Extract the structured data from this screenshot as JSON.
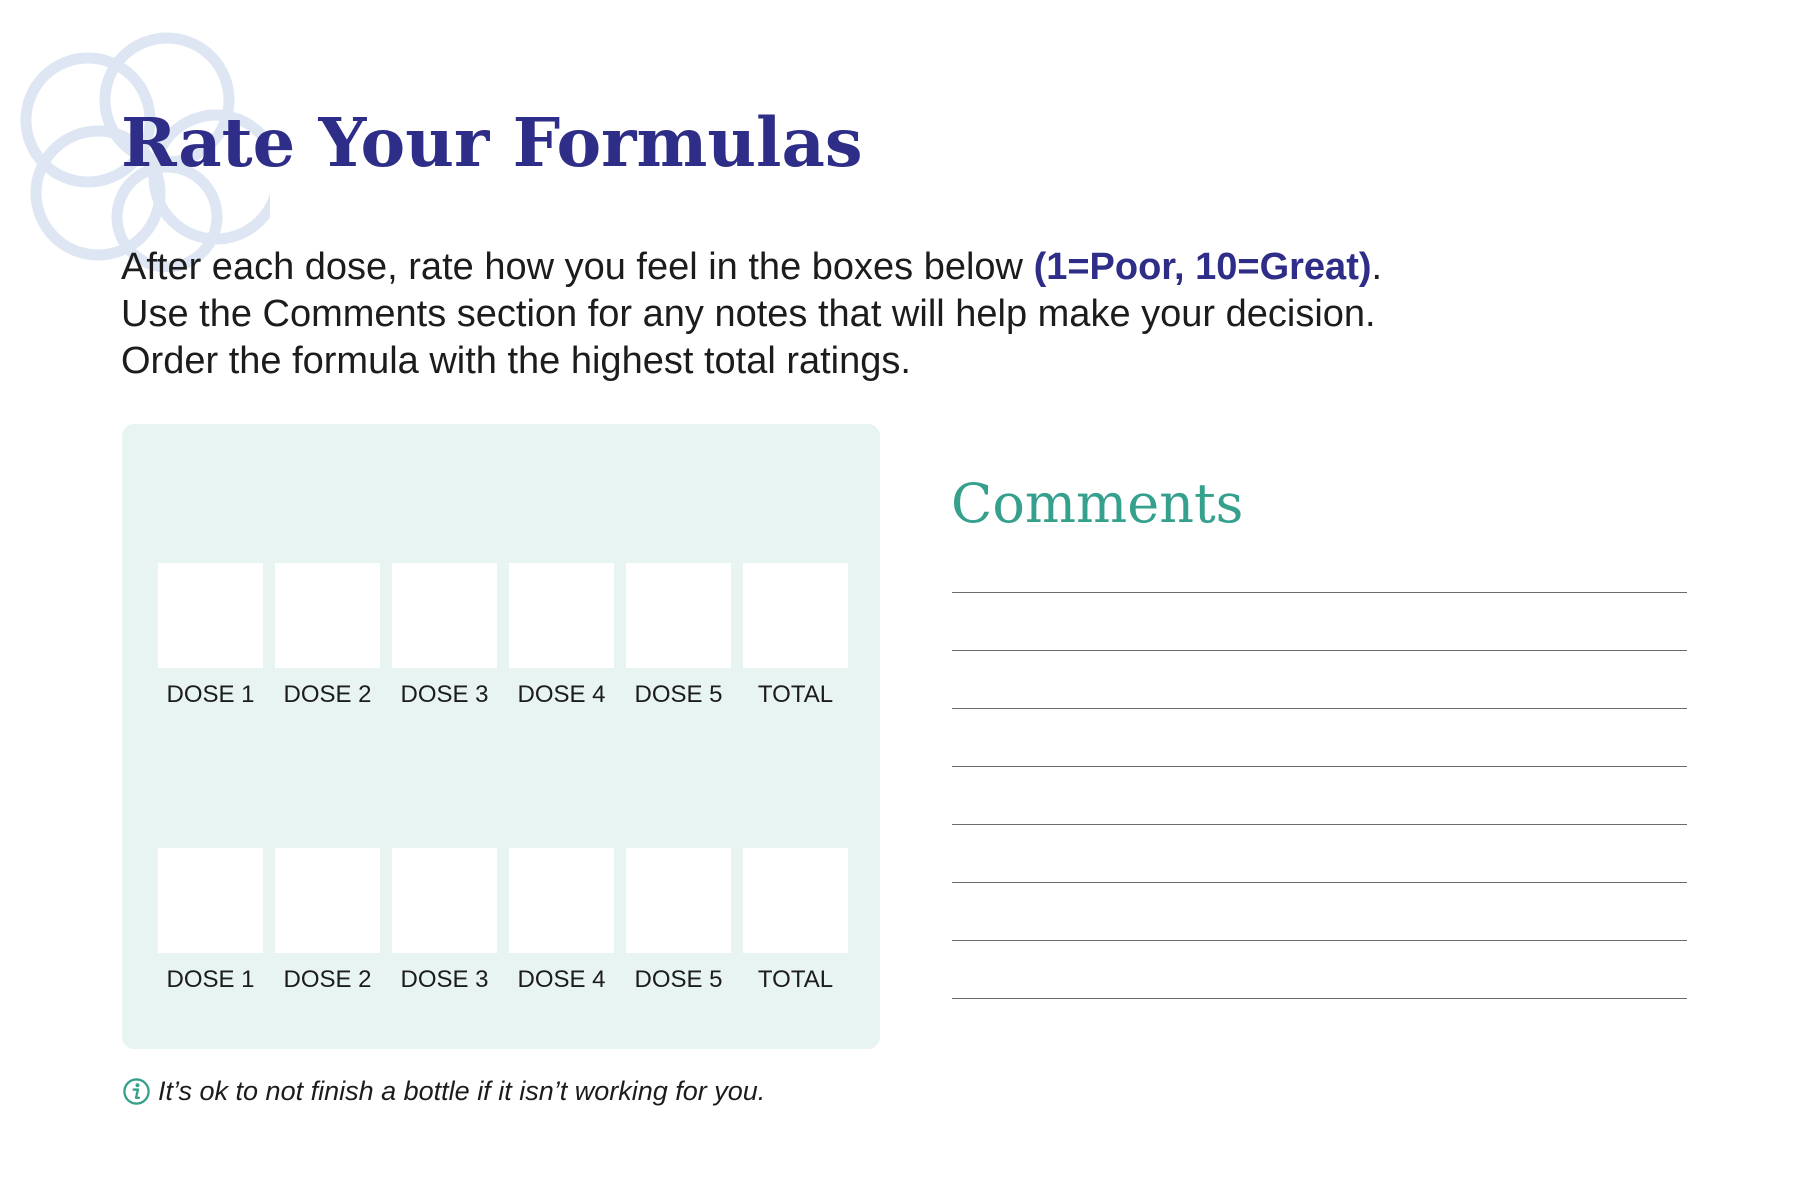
{
  "header": {
    "title": "Rate Your Formulas",
    "intro": {
      "line1_text": "After each dose, rate how you feel in the boxes below ",
      "line1_highlight": "(1=Poor, 10=Great)",
      "line1_end": ".",
      "line2": "Use the Comments section for any notes that will help make your decision.",
      "line3": "Order the formula with the highest total ratings."
    }
  },
  "rating_rows": [
    {
      "labels": [
        "DOSE 1",
        "DOSE 2",
        "DOSE 3",
        "DOSE 4",
        "DOSE 5",
        "TOTAL"
      ],
      "values": [
        "",
        "",
        "",
        "",
        "",
        ""
      ]
    },
    {
      "labels": [
        "DOSE 1",
        "DOSE 2",
        "DOSE 3",
        "DOSE 4",
        "DOSE 5",
        "TOTAL"
      ],
      "values": [
        "",
        "",
        "",
        "",
        "",
        ""
      ]
    }
  ],
  "comments": {
    "heading": "Comments",
    "line_count": 8
  },
  "footnote": {
    "icon": "info-icon",
    "text": "It’s ok to not finish a bottle if it isn’t working for you."
  },
  "colors": {
    "title": "#2e2d87",
    "highlight": "#2e2d87",
    "comments_heading": "#35a08c",
    "panel_background": "#e8f4f2",
    "info_icon": "#35a08c",
    "logo": "#dde6f2"
  }
}
